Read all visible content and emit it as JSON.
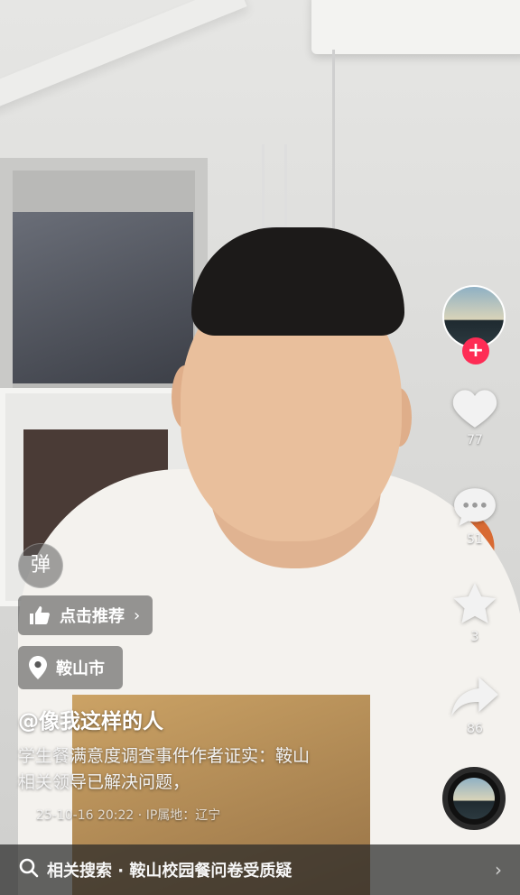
{
  "rail": {
    "like_count": "77",
    "comment_count": "51",
    "favorite_count": "3",
    "share_count": "86",
    "icons": {
      "like": "heart-icon",
      "comment": "comment-bubble-icon",
      "favorite": "star-icon",
      "share": "share-arrow-icon",
      "follow": "plus-icon"
    },
    "follow_symbol": "+"
  },
  "overlay": {
    "danmaku_label": "弹",
    "recommend_label": "点击推荐",
    "recommend_chevron": "›",
    "location_label": "鞍山市",
    "author_name": "@像我这样的人",
    "description_line1": "学生餐满意度调查事件作者证实：鞍山",
    "description_line2": "相关领导已解决问题，",
    "meta": "25-10-16 20:22 · IP属地：辽宁"
  },
  "search_bar": {
    "label": "相关搜索 · 鞍山校园餐问卷受质疑",
    "arrow": "›"
  },
  "colors": {
    "follow_badge": "#fe2c55",
    "overlay_chip": "rgba(70,70,70,.55)"
  }
}
